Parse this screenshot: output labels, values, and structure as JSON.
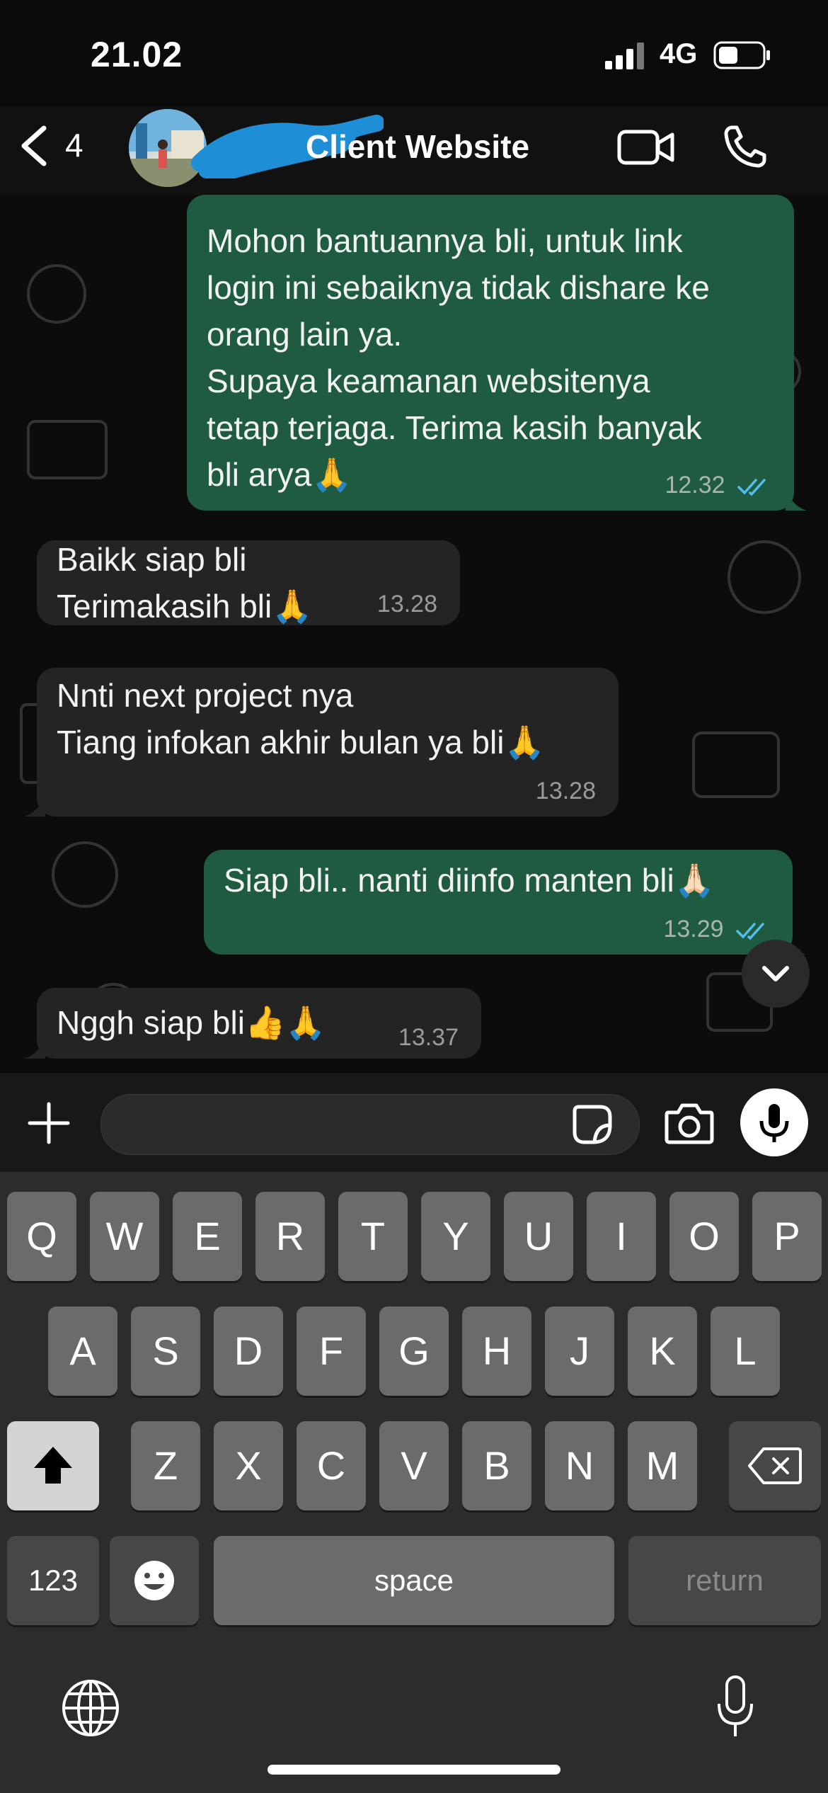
{
  "status": {
    "time": "21.02",
    "network": "4G"
  },
  "header": {
    "unread_count": "4",
    "contact_name": "Client Website"
  },
  "messages": [
    {
      "direction": "out",
      "lines": [
        "Mohon bantuannya bli, untuk link",
        "login ini sebaiknya tidak dishare ke",
        "orang lain ya.",
        "Supaya keamanan websitenya",
        "tetap terjaga. Terima kasih banyak",
        "bli arya🙏"
      ],
      "time": "12.32",
      "read": true
    },
    {
      "direction": "in",
      "lines": [
        "Baikk siap bli",
        "Terimakasih bli🙏"
      ],
      "time": "13.28"
    },
    {
      "direction": "in",
      "lines": [
        "Nnti next project nya",
        "Tiang infokan akhir bulan ya bli🙏"
      ],
      "time": "13.28"
    },
    {
      "direction": "out",
      "lines": [
        "Siap bli.. nanti diinfo manten bli🙏🏻"
      ],
      "time": "13.29",
      "read": true
    },
    {
      "direction": "in",
      "lines": [
        "Nggh siap bli👍🙏"
      ],
      "time": "13.37"
    }
  ],
  "keyboard": {
    "row1": [
      "Q",
      "W",
      "E",
      "R",
      "T",
      "Y",
      "U",
      "I",
      "O",
      "P"
    ],
    "row2": [
      "A",
      "S",
      "D",
      "F",
      "G",
      "H",
      "J",
      "K",
      "L"
    ],
    "row3": [
      "Z",
      "X",
      "C",
      "V",
      "B",
      "N",
      "M"
    ],
    "numbers_label": "123",
    "space_label": "space",
    "return_label": "return"
  },
  "colors": {
    "outgoing_bubble": "#1e5b41",
    "incoming_bubble": "#242424",
    "read_ticks": "#53bdeb"
  },
  "icons": [
    "back-chevron-icon",
    "video-call-icon",
    "phone-icon",
    "plus-icon",
    "sticker-icon",
    "camera-icon",
    "mic-icon",
    "shift-icon",
    "backspace-icon",
    "emoji-icon",
    "globe-icon",
    "dictation-icon",
    "chevron-down-icon"
  ]
}
